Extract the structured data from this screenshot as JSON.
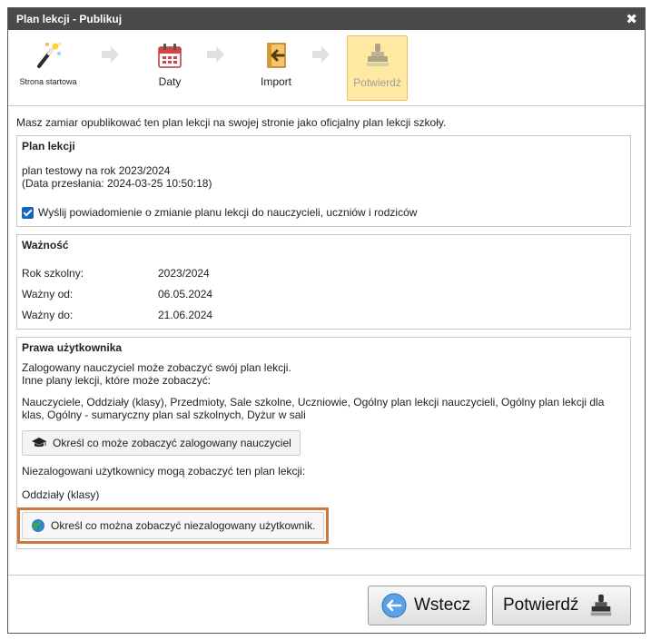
{
  "window": {
    "title": "Plan lekcji - Publikuj",
    "close_glyph": "✖"
  },
  "wizard": {
    "steps": [
      {
        "label": "Strona startowa",
        "icon": "magic-wand-icon"
      },
      {
        "label": "Daty",
        "icon": "calendar-icon"
      },
      {
        "label": "Import",
        "icon": "import-icon"
      },
      {
        "label": "Potwierdź",
        "icon": "stamp-icon",
        "active": true
      }
    ]
  },
  "intro": "Masz zamiar opublikować ten plan lekcji na swojej stronie jako oficjalny plan lekcji szkoły.",
  "plan": {
    "heading": "Plan lekcji",
    "name": "plan testowy na rok 2023/2024",
    "sent": "(Data przesłania: 2024-03-25 10:50:18)",
    "notify_label": "Wyślij powiadomienie o zmianie planu lekcji do nauczycieli, uczniów i rodziców",
    "notify_checked": true
  },
  "validity": {
    "heading": "Ważność",
    "rows": [
      {
        "label": "Rok szkolny:",
        "value": "2023/2024"
      },
      {
        "label": "Ważny od:",
        "value": "06.05.2024"
      },
      {
        "label": "Ważny do:",
        "value": "21.06.2024"
      }
    ]
  },
  "rights": {
    "heading": "Prawa użytkownika",
    "logged_line1": "Zalogowany nauczyciel może zobaczyć swój plan lekcji.",
    "logged_line2": "Inne plany lekcji, które może zobaczyć:",
    "logged_list": "Nauczyciele, Oddziały (klasy), Przedmioty, Sale szkolne, Uczniowie, Ogólny plan lekcji nauczycieli, Ogólny plan lekcji dla klas, Ogólny - sumaryczny plan sal szkolnych, Dyżur w sali",
    "logged_button": "Określ co może zobaczyć zalogowany nauczyciel",
    "anon_line": "Niezalogowani użytkownicy mogą zobaczyć ten plan lekcji:",
    "anon_list": "Oddziały (klasy)",
    "anon_button": "Określ co można zobaczyć niezalogowany użytkownik."
  },
  "footer": {
    "back": "Wstecz",
    "confirm": "Potwierdź"
  },
  "colors": {
    "titlebar": "#4a4a4a",
    "active_step": "#ffe9a3",
    "highlight": "#d2773a",
    "checkbox": "#1565c0"
  }
}
